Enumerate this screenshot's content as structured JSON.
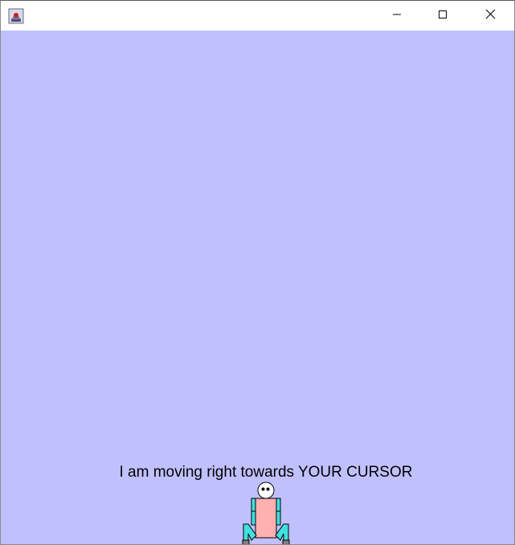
{
  "window": {
    "title": "",
    "app_icon": "java-app-icon",
    "controls": {
      "minimize_icon": "minimize-icon",
      "maximize_icon": "maximize-icon",
      "close_icon": "close-icon"
    }
  },
  "canvas": {
    "background_color": "#c0c0ff",
    "status_text": "I am moving right towards YOUR CURSOR"
  },
  "robot": {
    "head_color": "#ffffff",
    "body_color": "#ffb0b0",
    "arm_color": "#40e0e0",
    "foot_color": "#808080"
  }
}
